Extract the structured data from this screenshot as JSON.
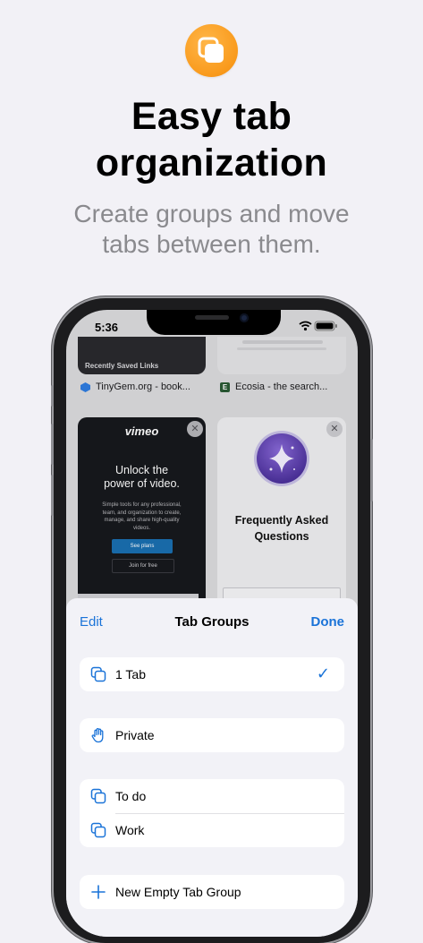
{
  "promo": {
    "headline": "Easy tab\norganization",
    "subhead": "Create groups and move\ntabs between them."
  },
  "status_bar": {
    "time": "5:36"
  },
  "tabs": [
    {
      "title": "TinyGem.org - book...",
      "banner": "Recently Saved Links"
    },
    {
      "title": "Ecosia - the search..."
    },
    {
      "brand": "vimeo",
      "heading": "Unlock the\npower of video.",
      "body": "Simple tools for any professional,\nteam, and organization to create,\nmanage, and share high-quality\nvideos.",
      "primary_cta": "See plans",
      "secondary_cta": "Join for free"
    },
    {
      "heading": "Frequently Asked\nQuestions"
    }
  ],
  "sheet": {
    "edit_label": "Edit",
    "title": "Tab Groups",
    "done_label": "Done",
    "groups": [
      {
        "label": "1 Tab",
        "selected": true
      },
      {
        "label": "Private"
      },
      {
        "label": "To do"
      },
      {
        "label": "Work"
      },
      {
        "label": "New Empty Tab Group"
      }
    ]
  },
  "colors": {
    "accent": "#1a73d8",
    "icon_orange": "#f99a1c"
  }
}
